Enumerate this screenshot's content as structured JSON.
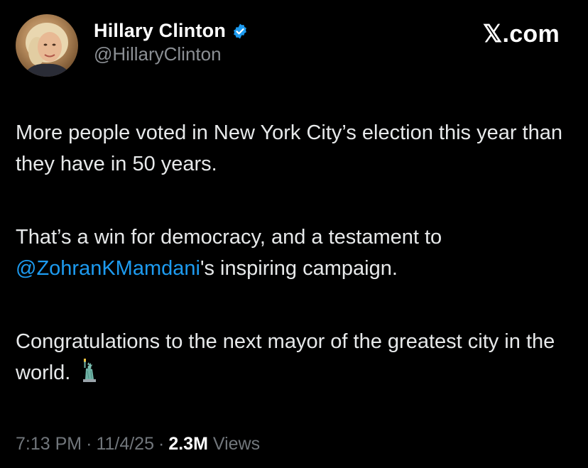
{
  "author": {
    "display_name": "Hillary Clinton",
    "handle": "@HillaryClinton",
    "verified": true,
    "verified_color": "#1d9bf0"
  },
  "brand": {
    "label": "𝕏.com"
  },
  "post": {
    "paragraph1": "More people voted in New York City’s election this year than they have in 50 years.",
    "paragraph2_mention": "@ZohranKMamdani",
    "paragraph2_after_mention": "'s inspiring campaign.",
    "paragraph2_before": "That’s a win for democracy, and a testament to ",
    "paragraph3": "Congratulations to the next mayor of the greatest city in the world.",
    "emoji": "statue-of-liberty"
  },
  "meta": {
    "time": "7:13 PM",
    "separator": "·",
    "date": "11/4/25",
    "views_count": "2.3M",
    "views_label": "Views"
  },
  "colors": {
    "background": "#000000",
    "text": "#e7e9ea",
    "muted": "#71767b",
    "link": "#1d9bf0"
  }
}
